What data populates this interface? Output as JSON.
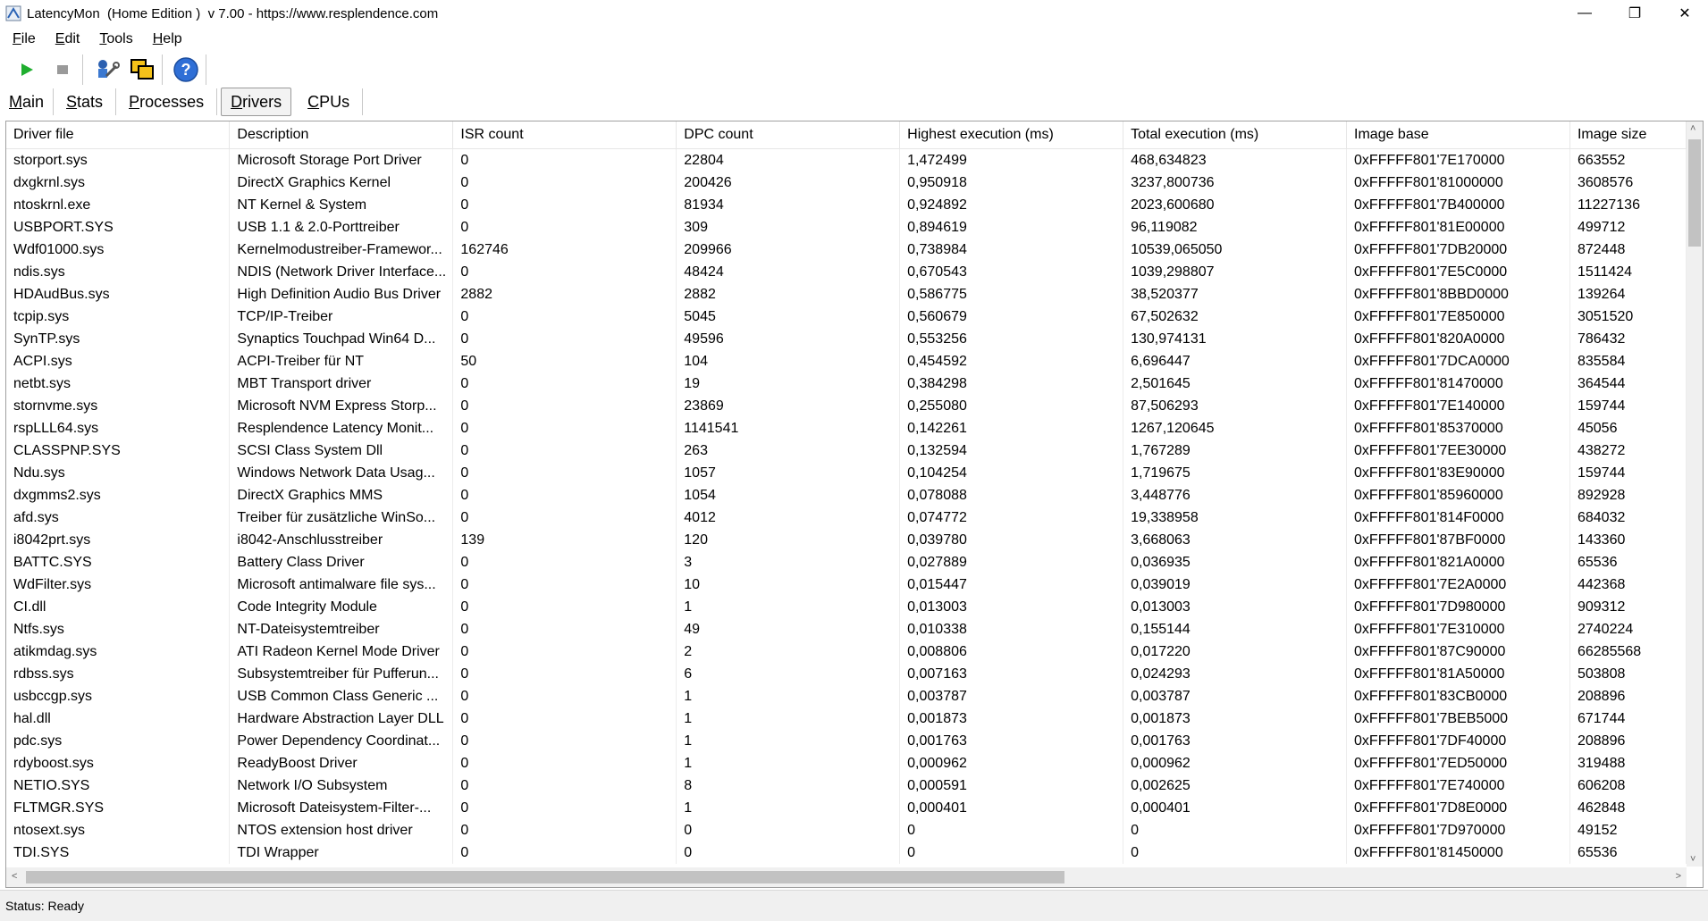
{
  "window": {
    "title": "LatencyMon  (Home Edition )  v 7.00 - https://www.resplendence.com",
    "minimize": "—",
    "maximize": "❐",
    "close": "✕"
  },
  "menu": [
    {
      "label": "File"
    },
    {
      "label": "Edit"
    },
    {
      "label": "Tools"
    },
    {
      "label": "Help"
    }
  ],
  "toolbar": {
    "start_icon": "play-icon",
    "stop_icon": "stop-icon",
    "tool1_icon": "wrench-user-icon",
    "tool2_icon": "window-stack-icon",
    "help_icon": "help-icon",
    "help_glyph": "?"
  },
  "tabs": [
    {
      "label": "Main",
      "active": false
    },
    {
      "label": "Stats",
      "active": false
    },
    {
      "label": "Processes",
      "active": false
    },
    {
      "label": "Drivers",
      "active": true
    },
    {
      "label": "CPUs",
      "active": false
    }
  ],
  "table": {
    "columns": [
      "Driver file",
      "Description",
      "ISR count",
      "DPC count",
      "Highest execution (ms)",
      "Total execution (ms)",
      "Image base",
      "Image size"
    ],
    "rows": [
      [
        "storport.sys",
        "Microsoft Storage Port Driver",
        "0",
        "22804",
        "1,472499",
        "468,634823",
        "0xFFFFF801'7E170000",
        "663552"
      ],
      [
        "dxgkrnl.sys",
        "DirectX Graphics Kernel",
        "0",
        "200426",
        "0,950918",
        "3237,800736",
        "0xFFFFF801'81000000",
        "3608576"
      ],
      [
        "ntoskrnl.exe",
        "NT Kernel & System",
        "0",
        "81934",
        "0,924892",
        "2023,600680",
        "0xFFFFF801'7B400000",
        "11227136"
      ],
      [
        "USBPORT.SYS",
        "USB 1.1 & 2.0-Porttreiber",
        "0",
        "309",
        "0,894619",
        "96,119082",
        "0xFFFFF801'81E00000",
        "499712"
      ],
      [
        "Wdf01000.sys",
        "Kernelmodustreiber-Framewor...",
        "162746",
        "209966",
        "0,738984",
        "10539,065050",
        "0xFFFFF801'7DB20000",
        "872448"
      ],
      [
        "ndis.sys",
        "NDIS (Network Driver Interface...",
        "0",
        "48424",
        "0,670543",
        "1039,298807",
        "0xFFFFF801'7E5C0000",
        "1511424"
      ],
      [
        "HDAudBus.sys",
        "High Definition Audio Bus Driver",
        "2882",
        "2882",
        "0,586775",
        "38,520377",
        "0xFFFFF801'8BBD0000",
        "139264"
      ],
      [
        "tcpip.sys",
        "TCP/IP-Treiber",
        "0",
        "5045",
        "0,560679",
        "67,502632",
        "0xFFFFF801'7E850000",
        "3051520"
      ],
      [
        "SynTP.sys",
        "Synaptics Touchpad Win64 D...",
        "0",
        "49596",
        "0,553256",
        "130,974131",
        "0xFFFFF801'820A0000",
        "786432"
      ],
      [
        "ACPI.sys",
        "ACPI-Treiber für NT",
        "50",
        "104",
        "0,454592",
        "6,696447",
        "0xFFFFF801'7DCA0000",
        "835584"
      ],
      [
        "netbt.sys",
        "MBT Transport driver",
        "0",
        "19",
        "0,384298",
        "2,501645",
        "0xFFFFF801'81470000",
        "364544"
      ],
      [
        "stornvme.sys",
        "Microsoft NVM Express Storp...",
        "0",
        "23869",
        "0,255080",
        "87,506293",
        "0xFFFFF801'7E140000",
        "159744"
      ],
      [
        "rspLLL64.sys",
        "Resplendence Latency Monit...",
        "0",
        "1141541",
        "0,142261",
        "1267,120645",
        "0xFFFFF801'85370000",
        "45056"
      ],
      [
        "CLASSPNP.SYS",
        "SCSI Class System Dll",
        "0",
        "263",
        "0,132594",
        "1,767289",
        "0xFFFFF801'7EE30000",
        "438272"
      ],
      [
        "Ndu.sys",
        "Windows Network Data Usag...",
        "0",
        "1057",
        "0,104254",
        "1,719675",
        "0xFFFFF801'83E90000",
        "159744"
      ],
      [
        "dxgmms2.sys",
        "DirectX Graphics MMS",
        "0",
        "1054",
        "0,078088",
        "3,448776",
        "0xFFFFF801'85960000",
        "892928"
      ],
      [
        "afd.sys",
        "Treiber für zusätzliche WinSo...",
        "0",
        "4012",
        "0,074772",
        "19,338958",
        "0xFFFFF801'814F0000",
        "684032"
      ],
      [
        "i8042prt.sys",
        "i8042-Anschlusstreiber",
        "139",
        "120",
        "0,039780",
        "3,668063",
        "0xFFFFF801'87BF0000",
        "143360"
      ],
      [
        "BATTC.SYS",
        "Battery Class Driver",
        "0",
        "3",
        "0,027889",
        "0,036935",
        "0xFFFFF801'821A0000",
        "65536"
      ],
      [
        "WdFilter.sys",
        "Microsoft antimalware file sys...",
        "0",
        "10",
        "0,015447",
        "0,039019",
        "0xFFFFF801'7E2A0000",
        "442368"
      ],
      [
        "CI.dll",
        "Code Integrity Module",
        "0",
        "1",
        "0,013003",
        "0,013003",
        "0xFFFFF801'7D980000",
        "909312"
      ],
      [
        "Ntfs.sys",
        "NT-Dateisystemtreiber",
        "0",
        "49",
        "0,010338",
        "0,155144",
        "0xFFFFF801'7E310000",
        "2740224"
      ],
      [
        "atikmdag.sys",
        "ATI Radeon Kernel Mode Driver",
        "0",
        "2",
        "0,008806",
        "0,017220",
        "0xFFFFF801'87C90000",
        "66285568"
      ],
      [
        "rdbss.sys",
        "Subsystemtreiber für Pufferun...",
        "0",
        "6",
        "0,007163",
        "0,024293",
        "0xFFFFF801'81A50000",
        "503808"
      ],
      [
        "usbccgp.sys",
        "USB Common Class Generic ...",
        "0",
        "1",
        "0,003787",
        "0,003787",
        "0xFFFFF801'83CB0000",
        "208896"
      ],
      [
        "hal.dll",
        "Hardware Abstraction Layer DLL",
        "0",
        "1",
        "0,001873",
        "0,001873",
        "0xFFFFF801'7BEB5000",
        "671744"
      ],
      [
        "pdc.sys",
        "Power Dependency Coordinat...",
        "0",
        "1",
        "0,001763",
        "0,001763",
        "0xFFFFF801'7DF40000",
        "208896"
      ],
      [
        "rdyboost.sys",
        "ReadyBoost Driver",
        "0",
        "1",
        "0,000962",
        "0,000962",
        "0xFFFFF801'7ED50000",
        "319488"
      ],
      [
        "NETIO.SYS",
        "Network I/O Subsystem",
        "0",
        "8",
        "0,000591",
        "0,002625",
        "0xFFFFF801'7E740000",
        "606208"
      ],
      [
        "FLTMGR.SYS",
        "Microsoft Dateisystem-Filter-...",
        "0",
        "1",
        "0,000401",
        "0,000401",
        "0xFFFFF801'7D8E0000",
        "462848"
      ],
      [
        "ntosext.sys",
        "NTOS extension host driver",
        "0",
        "0",
        "0",
        "0",
        "0xFFFFF801'7D970000",
        "49152"
      ],
      [
        "TDI.SYS",
        "TDI Wrapper",
        "0",
        "0",
        "0",
        "0",
        "0xFFFFF801'81450000",
        "65536"
      ]
    ]
  },
  "scroll": {
    "up": "˄",
    "down": "˅",
    "left": "<",
    "right": ">"
  },
  "status": "Status: Ready"
}
